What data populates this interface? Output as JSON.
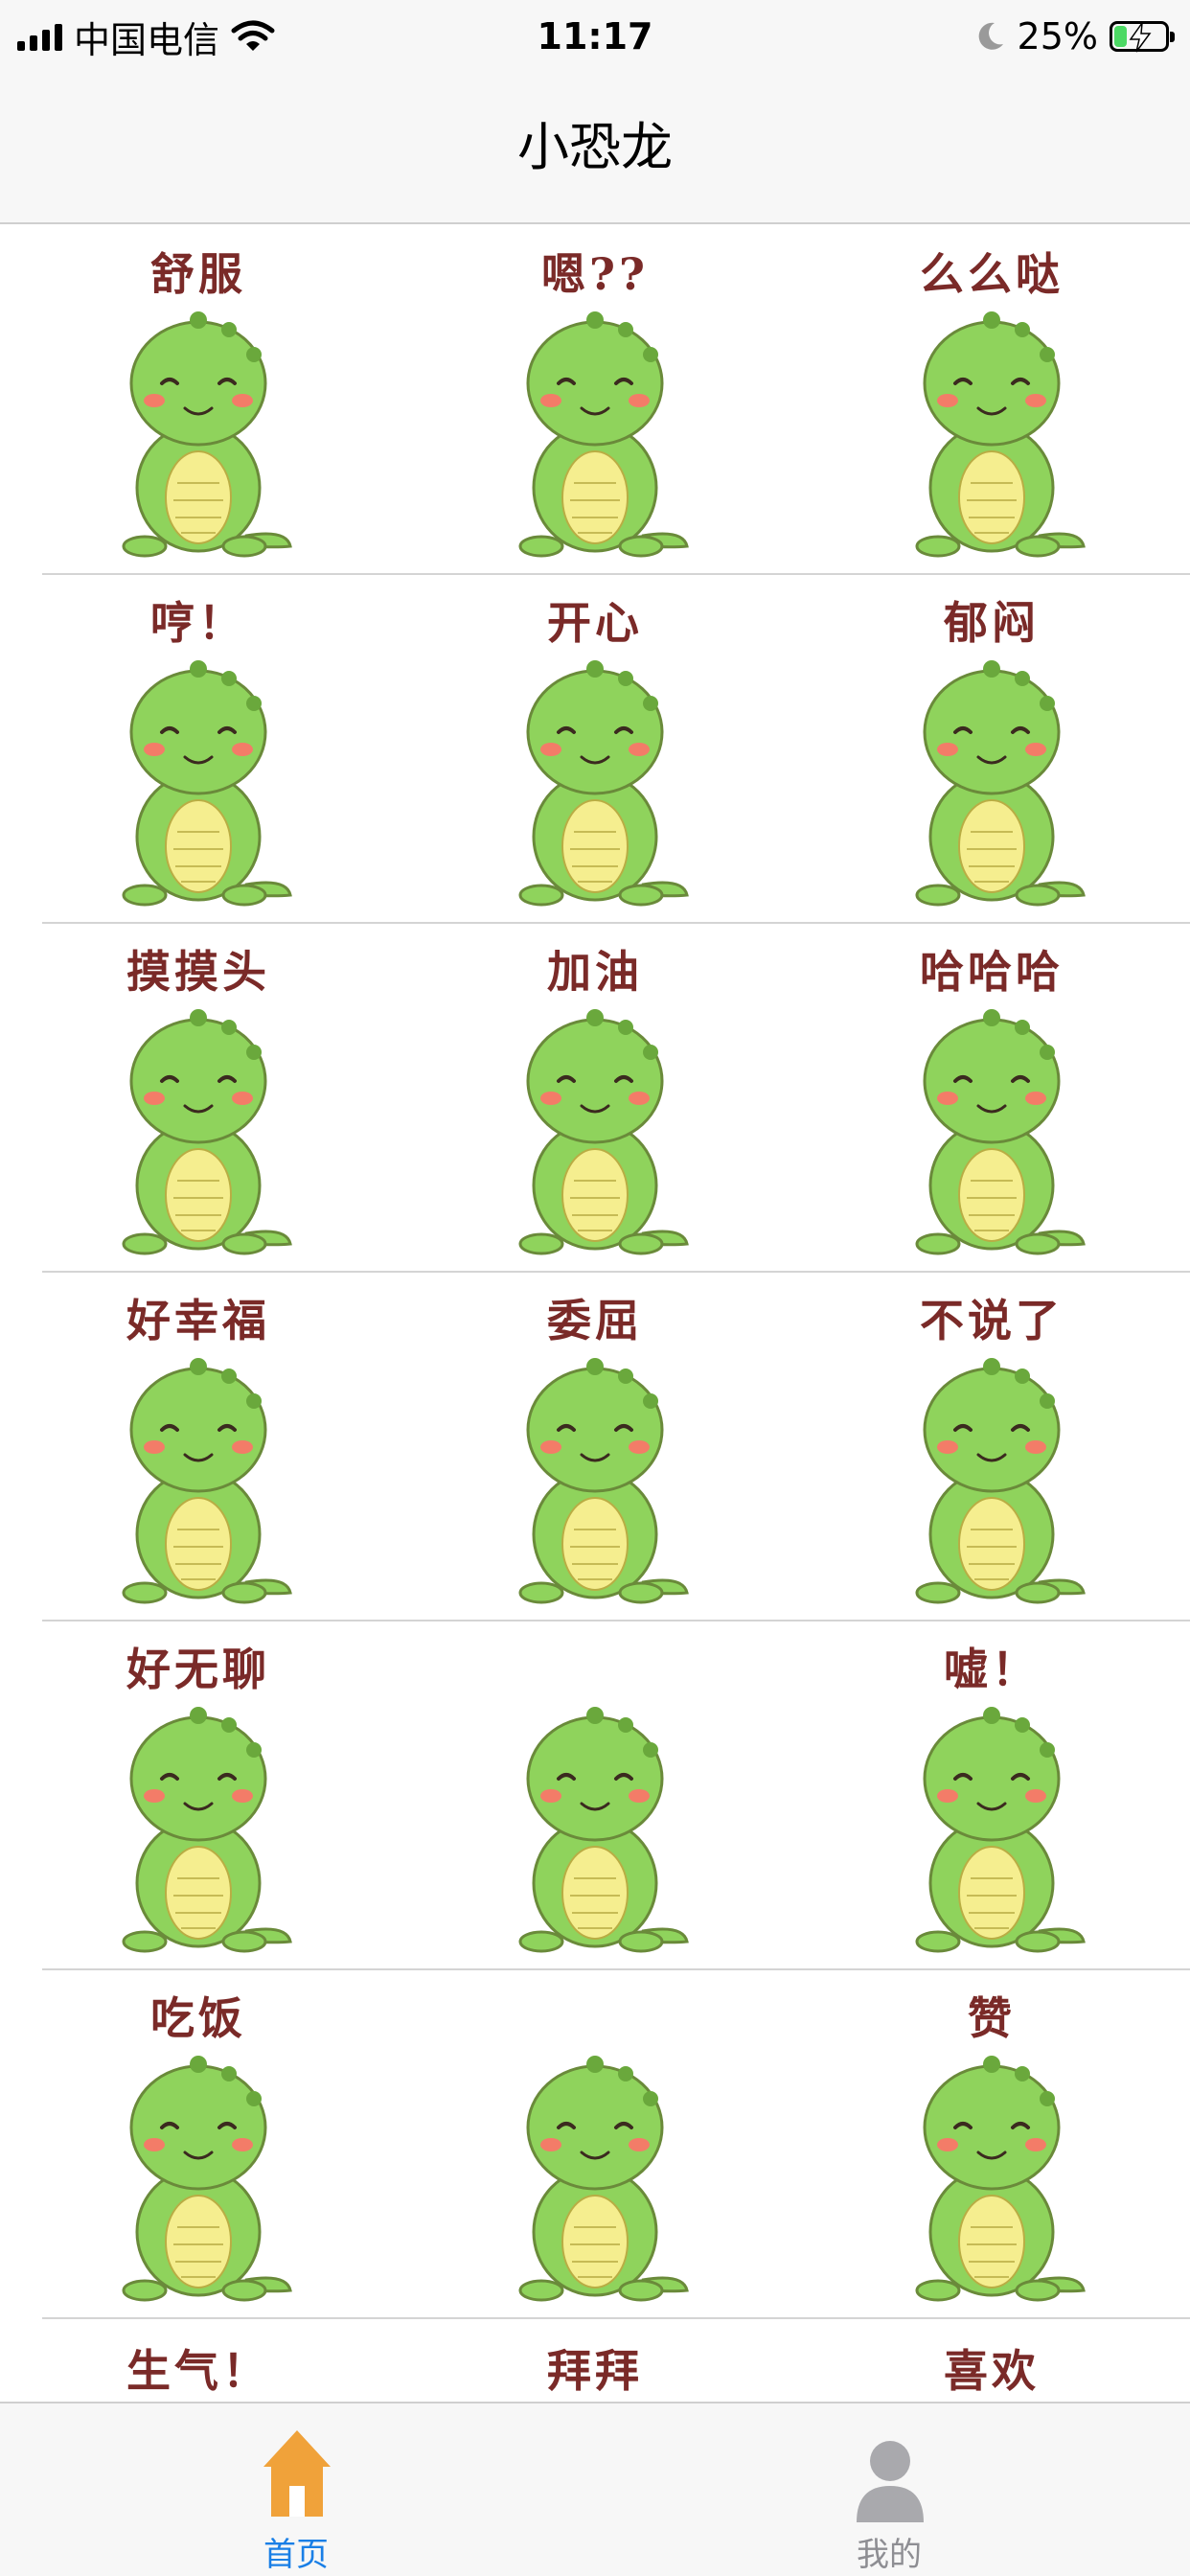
{
  "status_bar": {
    "carrier": "中国电信",
    "time": "11:17",
    "battery": "25%",
    "battery_level": 0.25,
    "icons": [
      "signal-icon",
      "wifi-icon",
      "moon-icon",
      "battery-icon",
      "charging-bolt-icon"
    ]
  },
  "nav": {
    "title": "小恐龙"
  },
  "stickers": [
    [
      {
        "caption": "舒服"
      },
      {
        "caption": "嗯??"
      },
      {
        "caption": "么么哒"
      }
    ],
    [
      {
        "caption": "哼！"
      },
      {
        "caption": "开心"
      },
      {
        "caption": "郁闷"
      }
    ],
    [
      {
        "caption": "摸摸头"
      },
      {
        "caption": "加油"
      },
      {
        "caption": "哈哈哈"
      }
    ],
    [
      {
        "caption": "好幸福"
      },
      {
        "caption": "委屈"
      },
      {
        "caption": "不说了"
      }
    ],
    [
      {
        "caption": "好无聊"
      },
      {
        "caption": ""
      },
      {
        "caption": "嘘！"
      }
    ],
    [
      {
        "caption": "吃饭"
      },
      {
        "caption": ""
      },
      {
        "caption": "赞"
      }
    ],
    [
      {
        "caption": "生气！"
      },
      {
        "caption": "拜拜"
      },
      {
        "caption": "喜欢"
      }
    ]
  ],
  "tabs": [
    {
      "label": "首页",
      "icon": "home-icon",
      "active": true
    },
    {
      "label": "我的",
      "icon": "person-icon",
      "active": false
    }
  ],
  "colors": {
    "accent": "#1a7fe6",
    "home_icon": "#f0a23a",
    "inactive": "#8e8e93",
    "dino_green": "#8fd35c",
    "dino_belly": "#f5ee8f",
    "caption": "#7a2a28"
  }
}
